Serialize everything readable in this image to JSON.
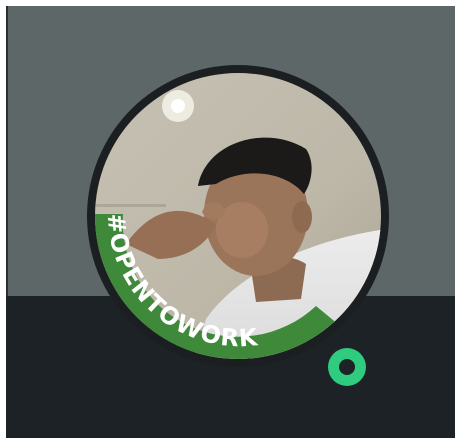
{
  "profile": {
    "badge_text": "#OPENTOWORK",
    "status": "online"
  },
  "colors": {
    "cover_background": "#5d6768",
    "panel_background": "#1d2226",
    "badge_green": "#3f8a3a",
    "status_green": "#2fcb7f"
  },
  "icons": {
    "status": "online-status-icon"
  }
}
